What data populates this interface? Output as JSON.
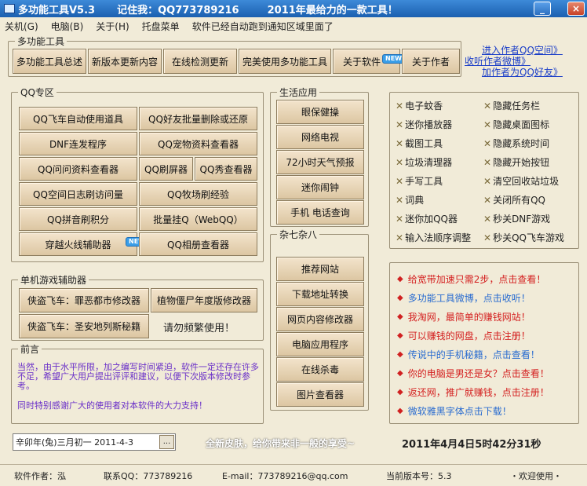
{
  "window": {
    "title": "多功能工具V5.3",
    "remember": "记住我：QQ773789216",
    "slogan": "2011年最给力的一款工具！"
  },
  "menu": [
    "关机(G)",
    "电脑(B)",
    "关于(H)",
    "托盘菜单",
    "软件已经自动跑到通知区域里面了"
  ],
  "top_group": {
    "label": "多功能工具",
    "buttons": [
      "多功能工具总述",
      "新版本更新内容",
      "在线检测更新",
      "完美使用多功能工具",
      "关于软件",
      "关于作者"
    ],
    "new_badge": "NEW"
  },
  "top_links": [
    "进入作者QQ空间》",
    "收听作者微博》",
    "加作者为QQ好友》"
  ],
  "qq_group": {
    "label": "QQ专区",
    "buttons": [
      "QQ飞车自动使用道具",
      "QQ好友批量删除或还原",
      "DNF连发程序",
      "QQ宠物资料查看器",
      "QQ问问资料查看器",
      "QQ刷屏器",
      "QQ秀查看器",
      "QQ空间日志刷访问量",
      "QQ牧场刷经验",
      "QQ拼音刷积分",
      "批量挂Q（WebQQ）",
      "穿越火线辅助器",
      "QQ相册查看器"
    ]
  },
  "game_group": {
    "label": "单机游戏辅助器",
    "buttons": [
      "侠盗飞车：罪恶都市修改器",
      "植物僵尸年度版修改器",
      "侠盗飞车：圣安地列斯秘籍"
    ],
    "warning": "请勿频繁使用！"
  },
  "preface": {
    "label": "前言",
    "text1": "当然，由于水平所限，加之编写时间紧迫，软件一定还存在许多不足，希望广大用户提出评评和建议，以便下次版本修改时参考。",
    "text2": "同时特别感谢广大的使用者对本软件的大力支持！"
  },
  "life_group": {
    "label": "生活应用",
    "buttons": [
      "眼保健操",
      "网络电视",
      "72小时天气预报",
      "迷你闹钟",
      "手机 电话查询"
    ]
  },
  "misc_group": {
    "label": "杂七杂八",
    "buttons": [
      "推荐网站",
      "下载地址转换",
      "网页内容修改器",
      "电脑应用程序",
      "在线杀毒",
      "图片查看器"
    ]
  },
  "tools": [
    "电子蚊香",
    "隐藏任务栏",
    "迷你播放器",
    "隐藏桌面图标",
    "截图工具",
    "隐藏系统时间",
    "垃圾清理器",
    "隐藏开始按钮",
    "手写工具",
    "清空回收站垃圾",
    "词典",
    "关闭所有QQ",
    "迷你加QQ器",
    "秒关DNF游戏",
    "输入法顺序调整",
    "秒关QQ飞车游戏"
  ],
  "ads": [
    {
      "text": "给宽带加速只需2步，点击查看！",
      "color": "#d42020"
    },
    {
      "text": "多功能工具微博，点击收听！",
      "color": "#2a6cd0"
    },
    {
      "text": "我淘网，最简单的赚钱网站！",
      "color": "#d42020"
    },
    {
      "text": "可以赚钱的网盘，点击注册！",
      "color": "#d42020"
    },
    {
      "text": "传说中的手机秘籍，点击查看！",
      "color": "#2a6cd0"
    },
    {
      "text": "你的电脑是男还是女？点击查看！",
      "color": "#d42020"
    },
    {
      "text": "返还网，推广就赚钱，点击注册！",
      "color": "#d42020"
    },
    {
      "text": "微软雅黑字体点击下载！",
      "color": "#2a6cd0"
    }
  ],
  "bottom": {
    "lunar_date": "辛卯年(兔)三月初一 2011-4-3",
    "lunar_btn": "...",
    "skin_text": "全新皮肤，给你带来非一般的享受~",
    "clock": "2011年4月4日5时42分31秒"
  },
  "status": {
    "author": "软件作者：泓",
    "qq": "联系QQ：773789216",
    "email": "E-mail：773789216@qq.com",
    "version": "当前版本号：5.3",
    "welcome": "・欢迎使用・"
  }
}
